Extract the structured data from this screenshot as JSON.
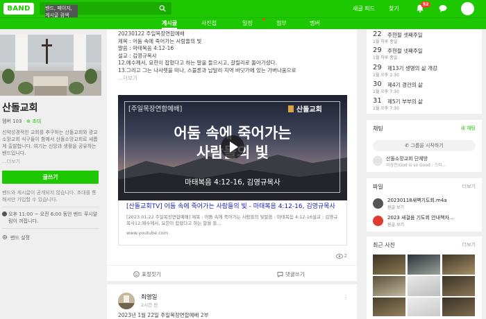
{
  "app": {
    "logo": "BAND"
  },
  "search": {
    "placeholder": "밴드, 페이지, 게시글 검색"
  },
  "header": {
    "new_feed": "새글 피드",
    "find": "찾기",
    "notification_count": "52"
  },
  "tabs": [
    {
      "label": "게시글",
      "active": true
    },
    {
      "label": "사진첩"
    },
    {
      "label": "일정"
    },
    {
      "label": "첨부"
    },
    {
      "label": "멤버"
    }
  ],
  "tab_badge": "N",
  "band": {
    "name": "산돌교회",
    "members": "멤버 103",
    "invite": "초대",
    "description": "신약성경적인 교회를 추구하는 산돌교회와 광교소망교회 식구들이 함께서 산돌소망교회로 새롭게 출발합니다. 여기는 신앙과 생활을 공유하는 밴드입니다.",
    "more": "...더보기",
    "write_button": "글쓰기",
    "notice": "밴드와 게시글이 공개되지 않습니다. 초대를 통해서만 가입할 수 있습니다.",
    "hours": "오후 11:00 ~ 오전 6:00 동안 밴드 푸시알림이 꺼집니다.",
    "settings": "밴드 설정"
  },
  "post": {
    "lines": [
      "20230122 주일목장연합예배",
      "제목 : 어둠 속에 죽어가는 사람들의 빛",
      "말씀 : 마태복음 4:12-16",
      "설교 : 김영규목사",
      "12.예수께서, 요한이 잡혔다고 하는 말을 들으시고, 갈릴리로 돌아가셨다.",
      "13.그리고 그는 나사렛을 떠나, 스불론과 납달리 지역 바닷가에 있는 가버나움으로"
    ],
    "more": "...더보기",
    "video": {
      "tag": "[주일목장연합예배]",
      "channel": "산돌교회",
      "title_line1": "어둠 속에 죽어가는",
      "title_line2": "사람들의 빛",
      "subtitle": "마태복음 4:12-16, 김영규목사"
    },
    "link": {
      "title": "[산돌교회TV] 어둠 속에 죽어가는 사람들의 빛 - 마태복음 4:12-16, 김영규목사",
      "description": "[2023.01.22 주일목장연합예배] 제목 : 어둠 속에 죽어가는 사람들의 빛말씀 : 마태복음 4:12-16설교 : 김영규목사12.예수께서, 요한이 잡혔다고 하는 말을 들...",
      "url": "www.youtube.com"
    },
    "view_count": "2",
    "actions": {
      "emotion": "표정짓기",
      "comment": "댓글쓰기"
    }
  },
  "post2": {
    "author": "최영일",
    "time": "2시간 전",
    "more": "⋮",
    "text": "2023년 1월 22일 주일목장연합예배 2부"
  },
  "schedule": [
    {
      "day": "22",
      "title": "주현절 셋째주일",
      "sub": "1월 하루 종일"
    },
    {
      "day": "29",
      "title": "주현절 넷째주일",
      "sub": "1월 하루 종일"
    },
    {
      "day": "29",
      "title": "제13기 생명의 삶 개강",
      "sub": "1월 오후 1:30"
    },
    {
      "day": "30",
      "title": "제4기 경건의 삶",
      "sub": "1월 오후 7:30"
    },
    {
      "day": "31",
      "title": "제5기 부부의 삶",
      "sub": "1월 오후 7:30"
    }
  ],
  "chat": {
    "heading": "채팅",
    "new_chat": "새 채팅",
    "start": "그룹을 시작하기",
    "room_name": "산돌소망교회 단체방",
    "room_last": "이상진/God is so Good : 스티..."
  },
  "files": {
    "heading": "파일",
    "more": "더보기",
    "items": [
      {
        "name": "20230118새벽기도회.m4a",
        "sub": "원글 보기",
        "type": "audio"
      },
      {
        "name": "2023 새걸음 기도회 안내책자...",
        "sub": "원글 보기",
        "type": "pdf"
      }
    ]
  },
  "photos": {
    "heading": "최근 사진",
    "more": "더보기"
  },
  "colors": {
    "brand": "#1ec800",
    "badge": "#ff3b30"
  }
}
